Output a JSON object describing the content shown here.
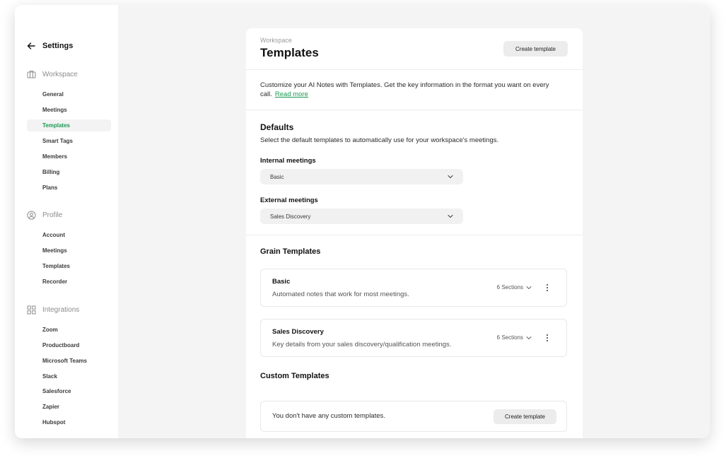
{
  "sidebar": {
    "title": "Settings",
    "groups": [
      {
        "label": "Workspace",
        "icon": "briefcase-icon",
        "items": [
          "General",
          "Meetings",
          "Templates",
          "Smart Tags",
          "Members",
          "Billing",
          "Plans"
        ]
      },
      {
        "label": "Profile",
        "icon": "user-circle-icon",
        "items": [
          "Account",
          "Meetings",
          "Templates",
          "Recorder"
        ]
      },
      {
        "label": "Integrations",
        "icon": "grid-icon",
        "items": [
          "Zoom",
          "Productboard",
          "Microsoft Teams",
          "Slack",
          "Salesforce",
          "Zapier",
          "Hubspot"
        ]
      }
    ],
    "active": "Workspace / Templates"
  },
  "header": {
    "eyebrow": "Workspace",
    "title": "Templates",
    "create_label": "Create template"
  },
  "intro": {
    "text": "Customize your AI Notes with Templates. Get the key information in the format you want on every call.",
    "link": "Read more"
  },
  "defaults": {
    "title": "Defaults",
    "description": "Select the default templates to automatically use for your workspace's meetings.",
    "internal_label": "Internal meetings",
    "internal_value": "Basic",
    "external_label": "External meetings",
    "external_value": "Sales Discovery"
  },
  "grain": {
    "title": "Grain Templates",
    "items": [
      {
        "name": "Basic",
        "description": "Automated notes that work for most meetings.",
        "sections": "6 Sections"
      },
      {
        "name": "Sales Discovery",
        "description": "Key details from your sales discovery/qualification meetings.",
        "sections": "6 Sections"
      }
    ]
  },
  "custom": {
    "title": "Custom Templates",
    "empty_text": "You don't have any custom templates.",
    "create_label": "Create template"
  },
  "colors": {
    "accent": "#1a9a53",
    "window_bg": "#f4f4f4"
  }
}
